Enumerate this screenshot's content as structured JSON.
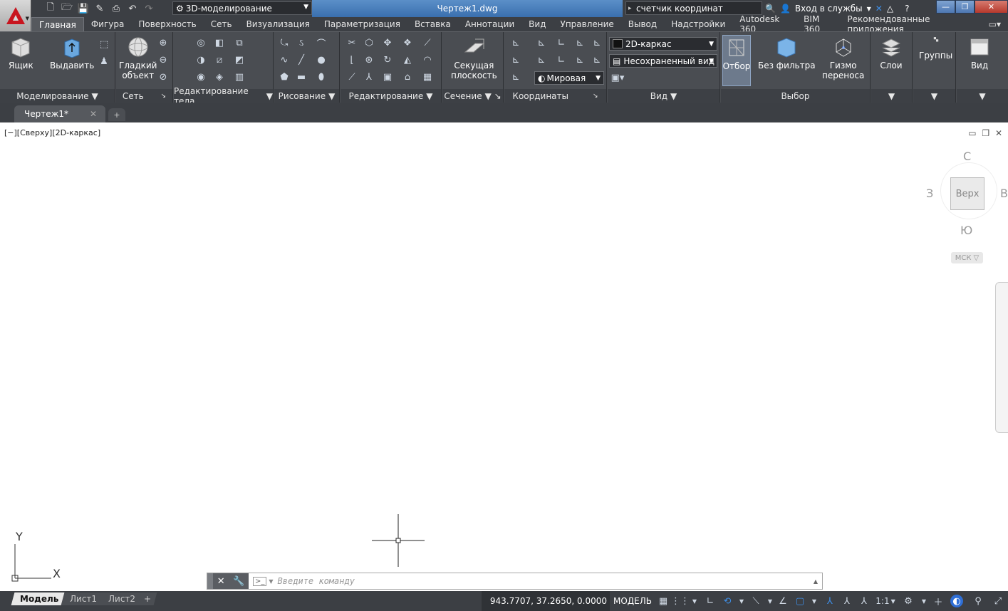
{
  "titlebar": {
    "workspace": "3D-моделирование",
    "document_title": "Чертеж1.dwg",
    "search_value": "счетчик координат",
    "login_label": "Вход в службы"
  },
  "tabs": [
    "Главная",
    "Фигура",
    "Поверхность",
    "Сеть",
    "Визуализация",
    "Параметризация",
    "Вставка",
    "Аннотации",
    "Вид",
    "Управление",
    "Вывод",
    "Надстройки",
    "Autodesk 360",
    "BIM 360",
    "Рекомендованные приложения"
  ],
  "ribbon": {
    "box_label": "Ящик",
    "extrude_label": "Выдавить",
    "smooth_label_1": "Гладкий",
    "smooth_label_2": "объект",
    "section_plane_1": "Секущая",
    "section_plane_2": "плоскость",
    "visual_style": "2D-каркас",
    "saved_view": "Несохраненный вид",
    "ucs_world": "Мировая",
    "select_label": "Отбор",
    "nofilter_label": "Без фильтра",
    "gizmo_1": "Гизмо",
    "gizmo_2": "переноса",
    "layers_label": "Слои",
    "groups_label": "Группы",
    "view_label": "Вид",
    "panels": {
      "modeling": "Моделирование",
      "mesh": "Сеть",
      "solid_edit": "Редактирование тела",
      "draw": "Рисование",
      "modify": "Редактирование",
      "section": "Сечение",
      "coords": "Координаты",
      "view": "Вид",
      "selection": "Выбор"
    }
  },
  "filetab": {
    "name": "Чертеж1*",
    "new": "+"
  },
  "viewport": {
    "label": "[−][Сверху][2D-каркас]",
    "cube": {
      "n": "С",
      "s": "Ю",
      "w": "З",
      "e": "В",
      "top": "Верх",
      "ucs": "МСК"
    },
    "axis_y": "Y",
    "axis_x": "X"
  },
  "command": {
    "placeholder": "Введите команду"
  },
  "status": {
    "layouts": [
      "Модель",
      "Лист1",
      "Лист2"
    ],
    "coords": "943.7707, 37.2650, 0.0000",
    "model": "МОДЕЛЬ",
    "scale": "1:1"
  },
  "colors": {
    "chrome": "#3c3f44",
    "ribbon": "#4a4d52",
    "title_blue": "#3a6fae",
    "autodesk_red": "#c8141e"
  }
}
